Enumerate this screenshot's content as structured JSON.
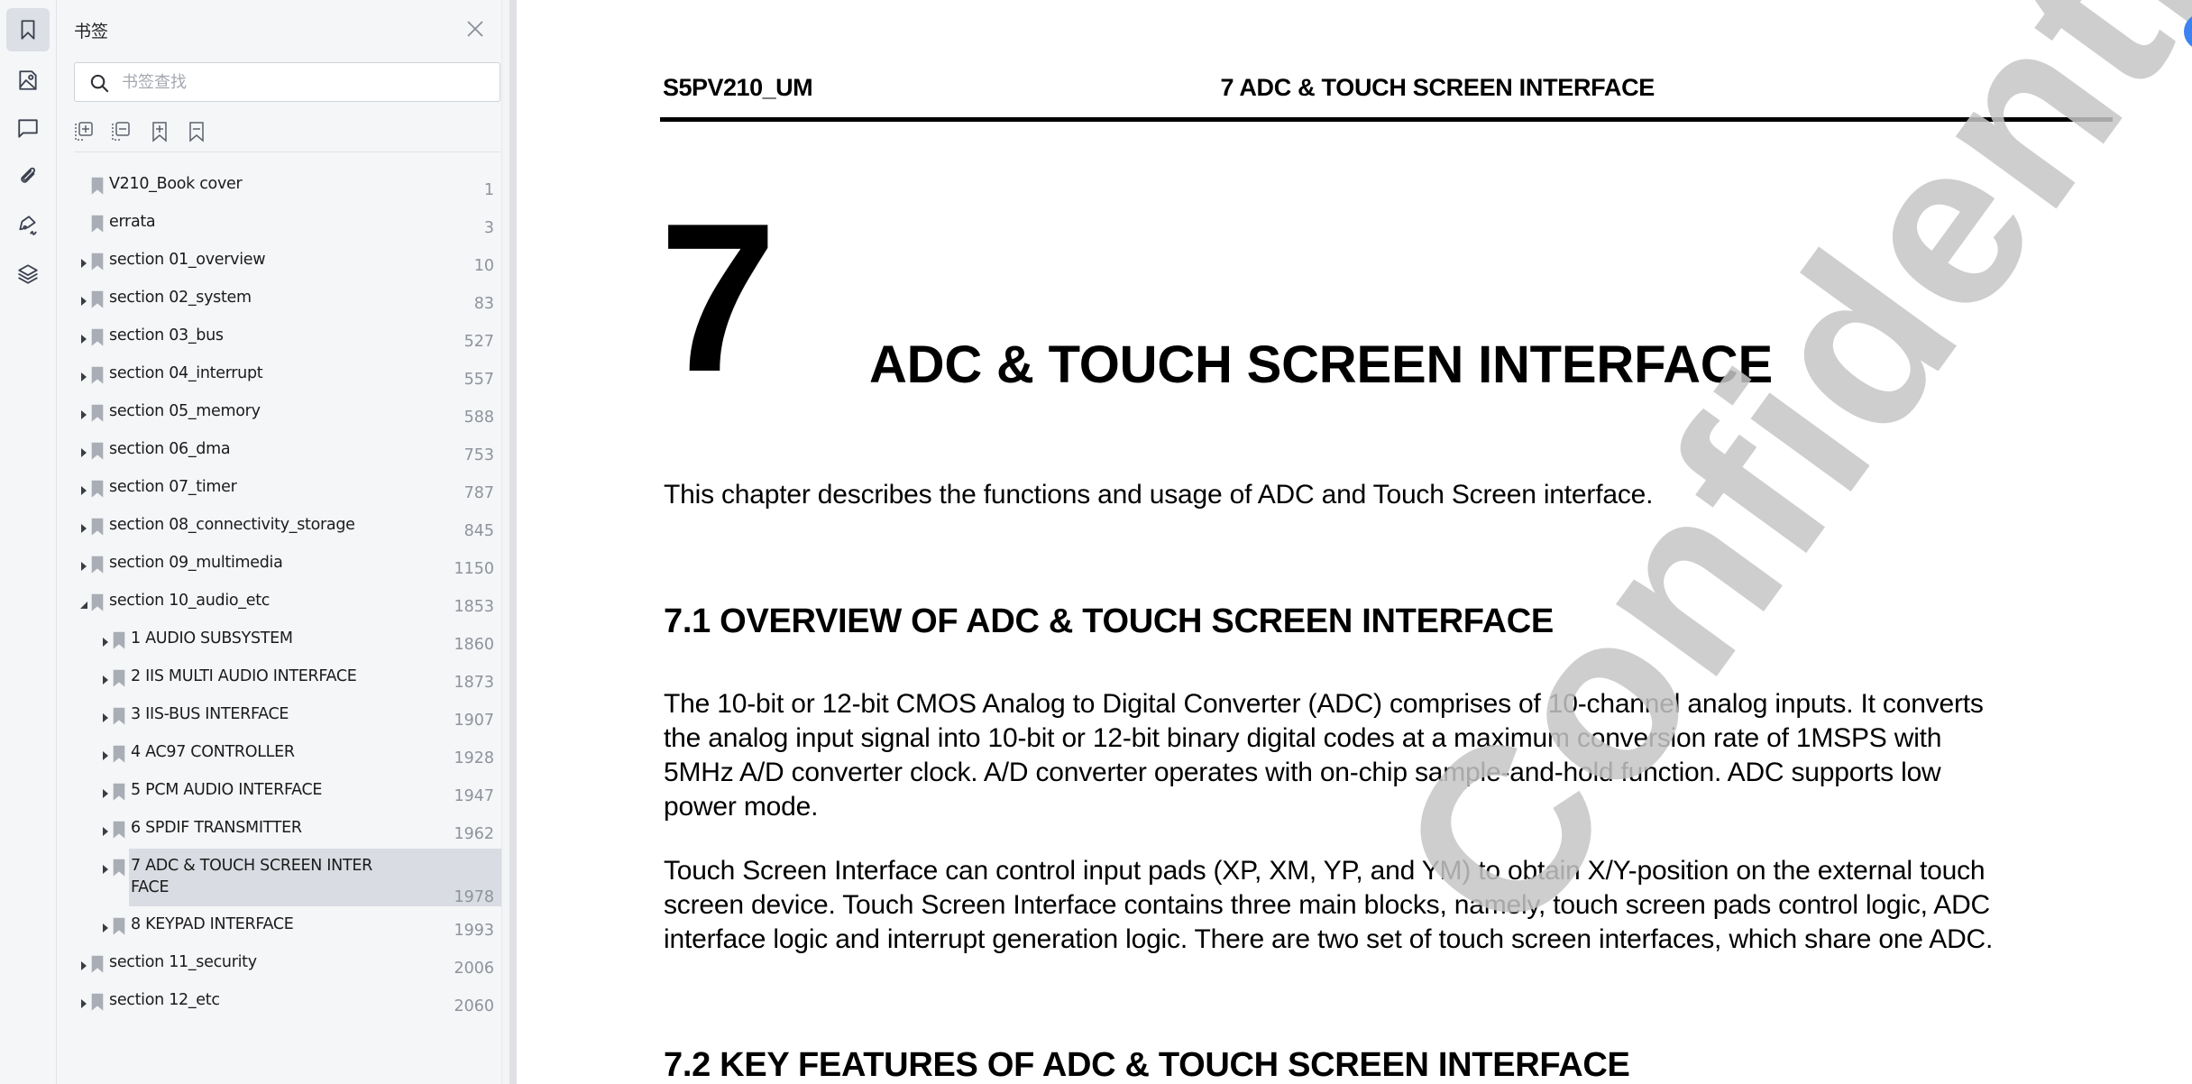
{
  "rail": {
    "items": [
      {
        "name": "bookmarks",
        "icon": "bookmark-icon",
        "active": true
      },
      {
        "name": "thumbnails",
        "icon": "image-icon",
        "active": false
      },
      {
        "name": "comments",
        "icon": "comment-icon",
        "active": false
      },
      {
        "name": "attachments",
        "icon": "paperclip-icon",
        "active": false
      },
      {
        "name": "signatures",
        "icon": "pen-nib-icon",
        "active": false
      },
      {
        "name": "layers",
        "icon": "layers-icon",
        "active": false
      }
    ]
  },
  "panel": {
    "title": "书签",
    "close_icon": "close-icon",
    "search": {
      "placeholder": "书签查找",
      "value": ""
    },
    "toolbar": [
      {
        "name": "expand-all",
        "icon": "expand-all-icon"
      },
      {
        "name": "collapse-all",
        "icon": "collapse-all-icon"
      },
      {
        "name": "add-bookmark",
        "icon": "bookmark-add-icon"
      },
      {
        "name": "remove-bookmark",
        "icon": "bookmark-remove-icon"
      }
    ],
    "bookmarks": [
      {
        "label": "V210_Book cover",
        "page": "1",
        "level": 0,
        "caret": "none"
      },
      {
        "label": "errata",
        "page": "3",
        "level": 0,
        "caret": "none"
      },
      {
        "label": "section 01_overview",
        "page": "10",
        "level": 0,
        "caret": "collapsed"
      },
      {
        "label": "section 02_system",
        "page": "83",
        "level": 0,
        "caret": "collapsed"
      },
      {
        "label": "section 03_bus",
        "page": "527",
        "level": 0,
        "caret": "collapsed"
      },
      {
        "label": "section 04_interrupt",
        "page": "557",
        "level": 0,
        "caret": "collapsed"
      },
      {
        "label": "section 05_memory",
        "page": "588",
        "level": 0,
        "caret": "collapsed"
      },
      {
        "label": "section 06_dma",
        "page": "753",
        "level": 0,
        "caret": "collapsed"
      },
      {
        "label": "section 07_timer",
        "page": "787",
        "level": 0,
        "caret": "collapsed"
      },
      {
        "label": "section 08_connectivity_storage",
        "page": "845",
        "level": 0,
        "caret": "collapsed"
      },
      {
        "label": "section 09_multimedia",
        "page": "1150",
        "level": 0,
        "caret": "collapsed"
      },
      {
        "label": "section 10_audio_etc",
        "page": "1853",
        "level": 0,
        "caret": "expanded"
      },
      {
        "label": "1 AUDIO SUBSYSTEM",
        "page": "1860",
        "level": 1,
        "caret": "collapsed"
      },
      {
        "label": "2 IIS MULTI AUDIO INTERFACE",
        "page": "1873",
        "level": 1,
        "caret": "collapsed"
      },
      {
        "label": "3 IIS-BUS INTERFACE",
        "page": "1907",
        "level": 1,
        "caret": "collapsed"
      },
      {
        "label": "4 AC97 CONTROLLER",
        "page": "1928",
        "level": 1,
        "caret": "collapsed"
      },
      {
        "label": "5 PCM AUDIO INTERFACE",
        "page": "1947",
        "level": 1,
        "caret": "collapsed"
      },
      {
        "label": "6 SPDIF TRANSMITTER",
        "page": "1962",
        "level": 1,
        "caret": "collapsed"
      },
      {
        "label": "7 ADC & TOUCH SCREEN INTER",
        "label2": "FACE",
        "page": "1978",
        "level": 1,
        "caret": "collapsed",
        "selected": true
      },
      {
        "label": "8 KEYPAD INTERFACE",
        "page": "1993",
        "level": 1,
        "caret": "collapsed"
      },
      {
        "label": "section 11_security",
        "page": "2006",
        "level": 0,
        "caret": "collapsed"
      },
      {
        "label": "section 12_etc",
        "page": "2060",
        "level": 0,
        "caret": "collapsed"
      }
    ]
  },
  "document": {
    "header_left": "S5PV210_UM",
    "header_right": "7 ADC & TOUCH SCREEN INTERFACE",
    "chapter_number": "7",
    "chapter_title": "ADC & TOUCH SCREEN INTERFACE",
    "intro": "This chapter describes the functions and usage of ADC and Touch Screen interface.",
    "section1_heading": "7.1  OVERVIEW OF ADC & TOUCH SCREEN INTERFACE",
    "para1_lines": [
      "The 10-bit or 12-bit CMOS Analog to Digital Converter (ADC) comprises of 10-channel analog inputs. It converts",
      "the analog input signal into 10-bit or 12-bit binary digital codes at a maximum conversion rate of 1MSPS with",
      "5MHz A/D converter clock. A/D converter operates with on-chip sample-and-hold function. ADC supports low",
      "power mode."
    ],
    "para2_lines": [
      "Touch Screen Interface can control input pads (XP, XM, YP, and YM) to obtain X/Y-position on the external touch",
      "screen device. Touch Screen Interface contains three main blocks, namely, touch screen pads control logic, ADC",
      "interface logic and interrupt generation logic. There are two set of touch screen interfaces, which share one ADC."
    ],
    "section2_heading": "7.2  KEY FEATURES OF ADC & TOUCH SCREEN INTERFACE",
    "watermark": "Confidential"
  },
  "colors": {
    "accent": "#3c82f0",
    "selected_row": "#d9dce2",
    "panel_bg": "#f5f6f8"
  }
}
